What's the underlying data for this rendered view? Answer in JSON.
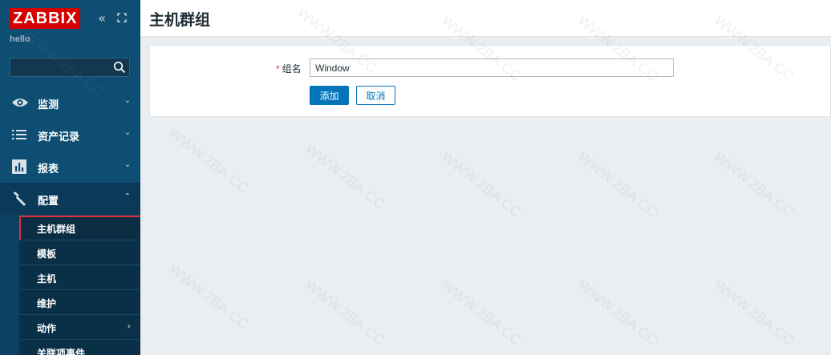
{
  "app": {
    "logo_text": "ZABBIX",
    "server_name": "hello",
    "brand_color": "#d40000"
  },
  "sidebar": {
    "collapse_icon": "double-chevron-left-icon",
    "kiosk_icon": "kiosk-mode-icon",
    "search": {
      "value": "",
      "placeholder": "",
      "icon": "search-icon"
    },
    "menu": [
      {
        "label": "监测",
        "icon": "eye-icon",
        "expanded": false
      },
      {
        "label": "资产记录",
        "icon": "list-icon",
        "expanded": false
      },
      {
        "label": "报表",
        "icon": "bar-chart-icon",
        "expanded": false
      },
      {
        "label": "配置",
        "icon": "wrench-icon",
        "expanded": true
      }
    ],
    "submenu": [
      {
        "label": "主机群组",
        "selected": true
      },
      {
        "label": "模板"
      },
      {
        "label": "主机"
      },
      {
        "label": "维护"
      },
      {
        "label": "动作",
        "has_children": true
      },
      {
        "label": "关联项事件"
      }
    ]
  },
  "header": {
    "title": "主机群组"
  },
  "form": {
    "group_name_label": "组名",
    "required_mark": "*",
    "group_name_value": "Window",
    "add_button": "添加",
    "cancel_button": "取消"
  },
  "watermark": {
    "text": "WWW.2BA.CC"
  }
}
